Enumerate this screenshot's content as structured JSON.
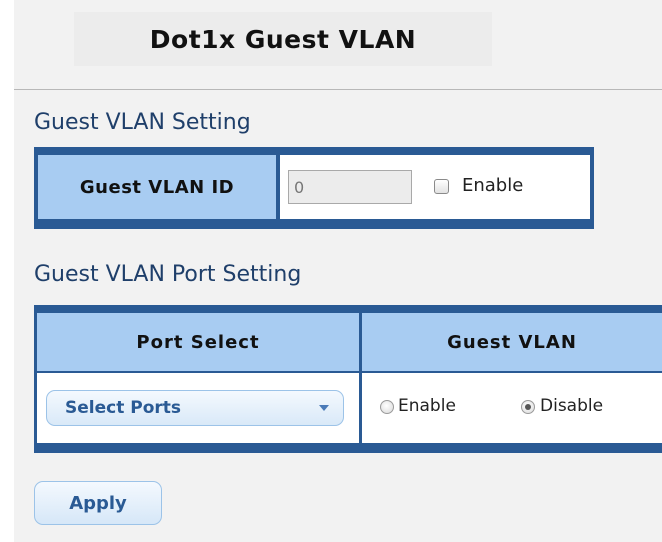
{
  "page": {
    "title": "Dot1x Guest VLAN"
  },
  "guest_vlan_setting": {
    "heading": "Guest VLAN Setting",
    "vlan_id_label": "Guest VLAN ID",
    "vlan_id_value": "0",
    "enable_label": "Enable",
    "enable_checked": false
  },
  "port_setting": {
    "heading": "Guest VLAN Port Setting",
    "columns": [
      "Port Select",
      "Guest VLAN"
    ],
    "select_ports_label": "Select Ports",
    "radio_enable_label": "Enable",
    "radio_disable_label": "Disable",
    "selected": "Disable"
  },
  "actions": {
    "apply_label": "Apply"
  },
  "colors": {
    "table_border": "#2a5a94",
    "header_bg": "#a8ccf2",
    "section_title": "#1f3f6a"
  },
  "icons": {
    "select_caret": "chevron-down-icon"
  }
}
